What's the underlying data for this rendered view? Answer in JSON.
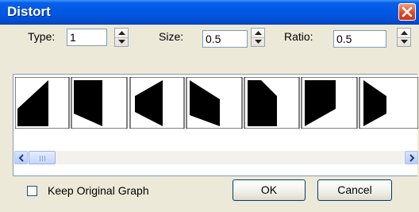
{
  "window": {
    "title": "Distort",
    "close_icon": "close-icon"
  },
  "params": {
    "type_label": "Type:",
    "type_value": "1",
    "size_label": "Size:",
    "size_value": "0.5",
    "ratio_label": "Ratio:",
    "ratio_value": "0.5"
  },
  "preview": {
    "items": [
      {
        "name": "distort-shape-1"
      },
      {
        "name": "distort-shape-2"
      },
      {
        "name": "distort-shape-3"
      },
      {
        "name": "distort-shape-4"
      },
      {
        "name": "distort-shape-5"
      },
      {
        "name": "distort-shape-6"
      },
      {
        "name": "distort-shape-7"
      }
    ]
  },
  "footer": {
    "keep_original_label": "Keep Original Graph",
    "keep_original_checked": false,
    "ok_label": "OK",
    "cancel_label": "Cancel"
  },
  "colors": {
    "title_bar": "#0058e6",
    "dialog_bg": "#ece9d8",
    "close_button": "#dd4a22"
  }
}
